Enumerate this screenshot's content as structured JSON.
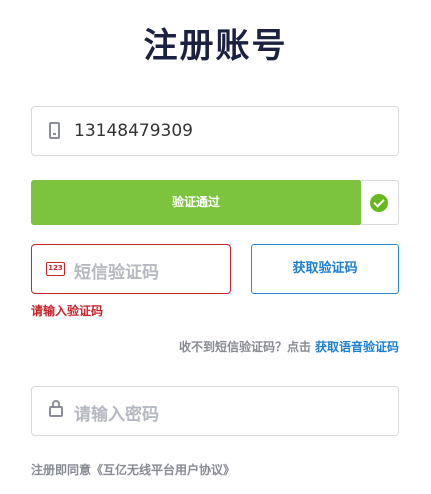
{
  "page": {
    "title": "注册账号"
  },
  "phone": {
    "value": "13148479309"
  },
  "verify": {
    "label": "验证通过",
    "status": "success"
  },
  "sms_code": {
    "placeholder": "短信验证码",
    "icon_text": "123",
    "error": "请输入验证码"
  },
  "get_code_button": {
    "label": "获取验证码"
  },
  "voice": {
    "prompt": "收不到短信验证码？点击",
    "link": "获取语音验证码"
  },
  "password": {
    "placeholder": "请输入密码"
  },
  "agreement": {
    "text": "注册即同意《互亿无线平台用户协议》"
  },
  "colors": {
    "accent": "#1d7fd0",
    "success": "#7dc43e",
    "error": "#c8232c",
    "title": "#1b2140"
  }
}
